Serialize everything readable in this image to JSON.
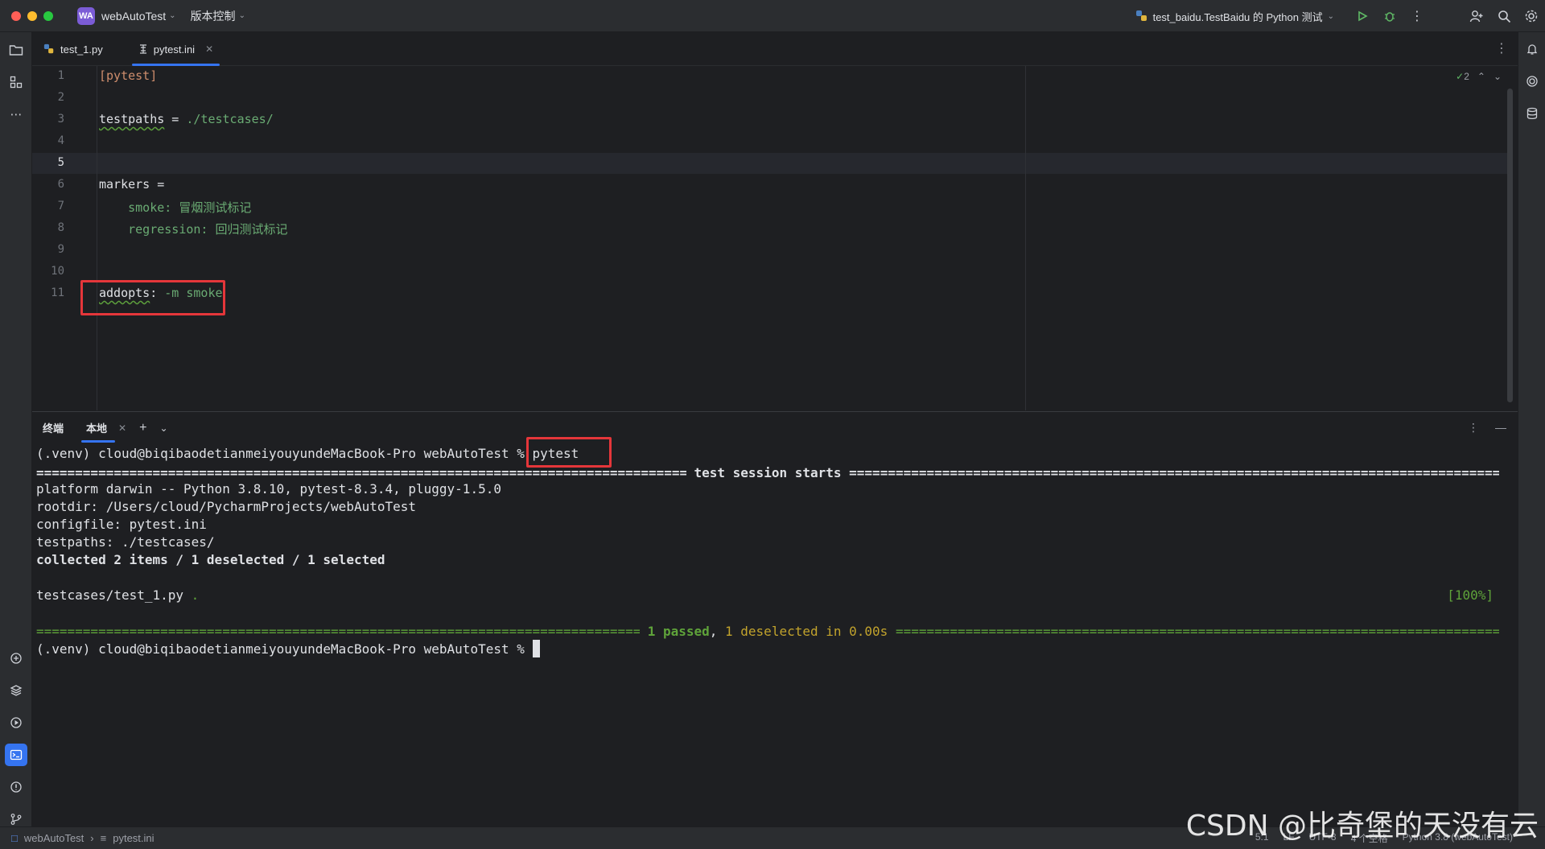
{
  "titlebar": {
    "project_badge": "WA",
    "project_name": "webAutoTest",
    "vcs_menu": "版本控制",
    "run_config": "test_baidu.TestBaidu 的 Python 测试",
    "colors": {
      "close": "#ff5f57",
      "minimize": "#febc2e",
      "maximize": "#28c840",
      "badge": "#7b5cd6"
    }
  },
  "tabs": [
    {
      "label": "test_1.py",
      "icon": "python-file-icon",
      "active": false
    },
    {
      "label": "pytest.ini",
      "icon": "ini-file-icon",
      "active": true
    }
  ],
  "editor": {
    "inspection_count": "2",
    "line_numbers": [
      "1",
      "2",
      "3",
      "4",
      "5",
      "6",
      "7",
      "8",
      "9",
      "10",
      "11"
    ],
    "lines": {
      "l1": "[pytest]",
      "l3_key": "testpaths",
      "l3_op": " = ",
      "l3_val": "./testcases/",
      "l6": "markers =",
      "l7_key": "    smoke: ",
      "l7_val": "冒烟测试标记",
      "l8_key": "    regression: ",
      "l8_val": "回归测试标记",
      "l11_key": "addopts",
      "l11_op": ": ",
      "l11_val": "-m smoke"
    }
  },
  "terminal": {
    "title": "终端",
    "tab_label": "本地",
    "prompt": "(.venv) cloud@biqibaodetianmeiyouyundeMacBook-Pro webAutoTest ",
    "command": "% pytest",
    "session_header": " test session starts ",
    "platform": "platform darwin -- Python 3.8.10, pytest-8.3.4, pluggy-1.5.0",
    "rootdir": "rootdir: /Users/cloud/PycharmProjects/webAutoTest",
    "configfile": "configfile: pytest.ini",
    "testpaths": "testpaths: ./testcases/",
    "collected": "collected 2 items / 1 deselected / 1 selected",
    "test_file": "testcases/test_1.py ",
    "test_dot": ".",
    "progress": "[100%]",
    "summary_passed": "1 passed",
    "summary_sep": ", ",
    "summary_deselected": "1 deselected in 0.00s",
    "final_prompt": "(.venv) cloud@biqibaodetianmeiyouyundeMacBook-Pro webAutoTest % "
  },
  "statusbar": {
    "crumb_project": "webAutoTest",
    "crumb_file": "pytest.ini",
    "position": "5:1",
    "line_sep": "LF",
    "encoding": "UTF-8",
    "indent": "4 个空格",
    "interpreter": "Python 3.8 (webAutoTest)"
  },
  "watermark": "CSDN @比奇堡的天没有云"
}
